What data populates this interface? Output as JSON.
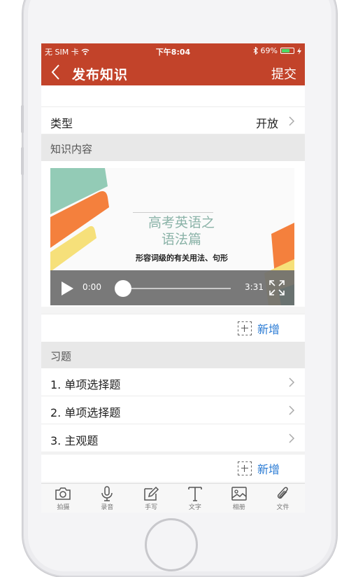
{
  "status_bar": {
    "carrier": "无 SIM 卡",
    "time": "下午8:04",
    "battery": "69%",
    "battery_level": 0.69
  },
  "nav": {
    "title": "发布知识",
    "submit_label": "提交"
  },
  "type_row": {
    "label": "类型",
    "value": "开放"
  },
  "knowledge_section": {
    "header": "知识内容",
    "video": {
      "slide_title_line1": "高考英语之",
      "slide_title_line2": "语法篇",
      "slide_subtitle": "形容词级的有关用法、句形",
      "current_time": "0:00",
      "duration": "3:31",
      "progress": 0
    },
    "add_label": "新增"
  },
  "exercise_section": {
    "header": "习题",
    "items": [
      {
        "label": "1. 单项选择题"
      },
      {
        "label": "2. 单项选择题"
      },
      {
        "label": "3. 主观题"
      }
    ],
    "add_label": "新增"
  },
  "toolbar": {
    "items": [
      {
        "label": "拍摄",
        "icon": "camera-icon"
      },
      {
        "label": "录音",
        "icon": "microphone-icon"
      },
      {
        "label": "手写",
        "icon": "pencil-icon"
      },
      {
        "label": "文字",
        "icon": "text-icon"
      },
      {
        "label": "相册",
        "icon": "image-icon"
      },
      {
        "label": "文件",
        "icon": "paperclip-icon"
      }
    ]
  },
  "colors": {
    "accent": "#c2432a",
    "link": "#2a7bd4"
  }
}
